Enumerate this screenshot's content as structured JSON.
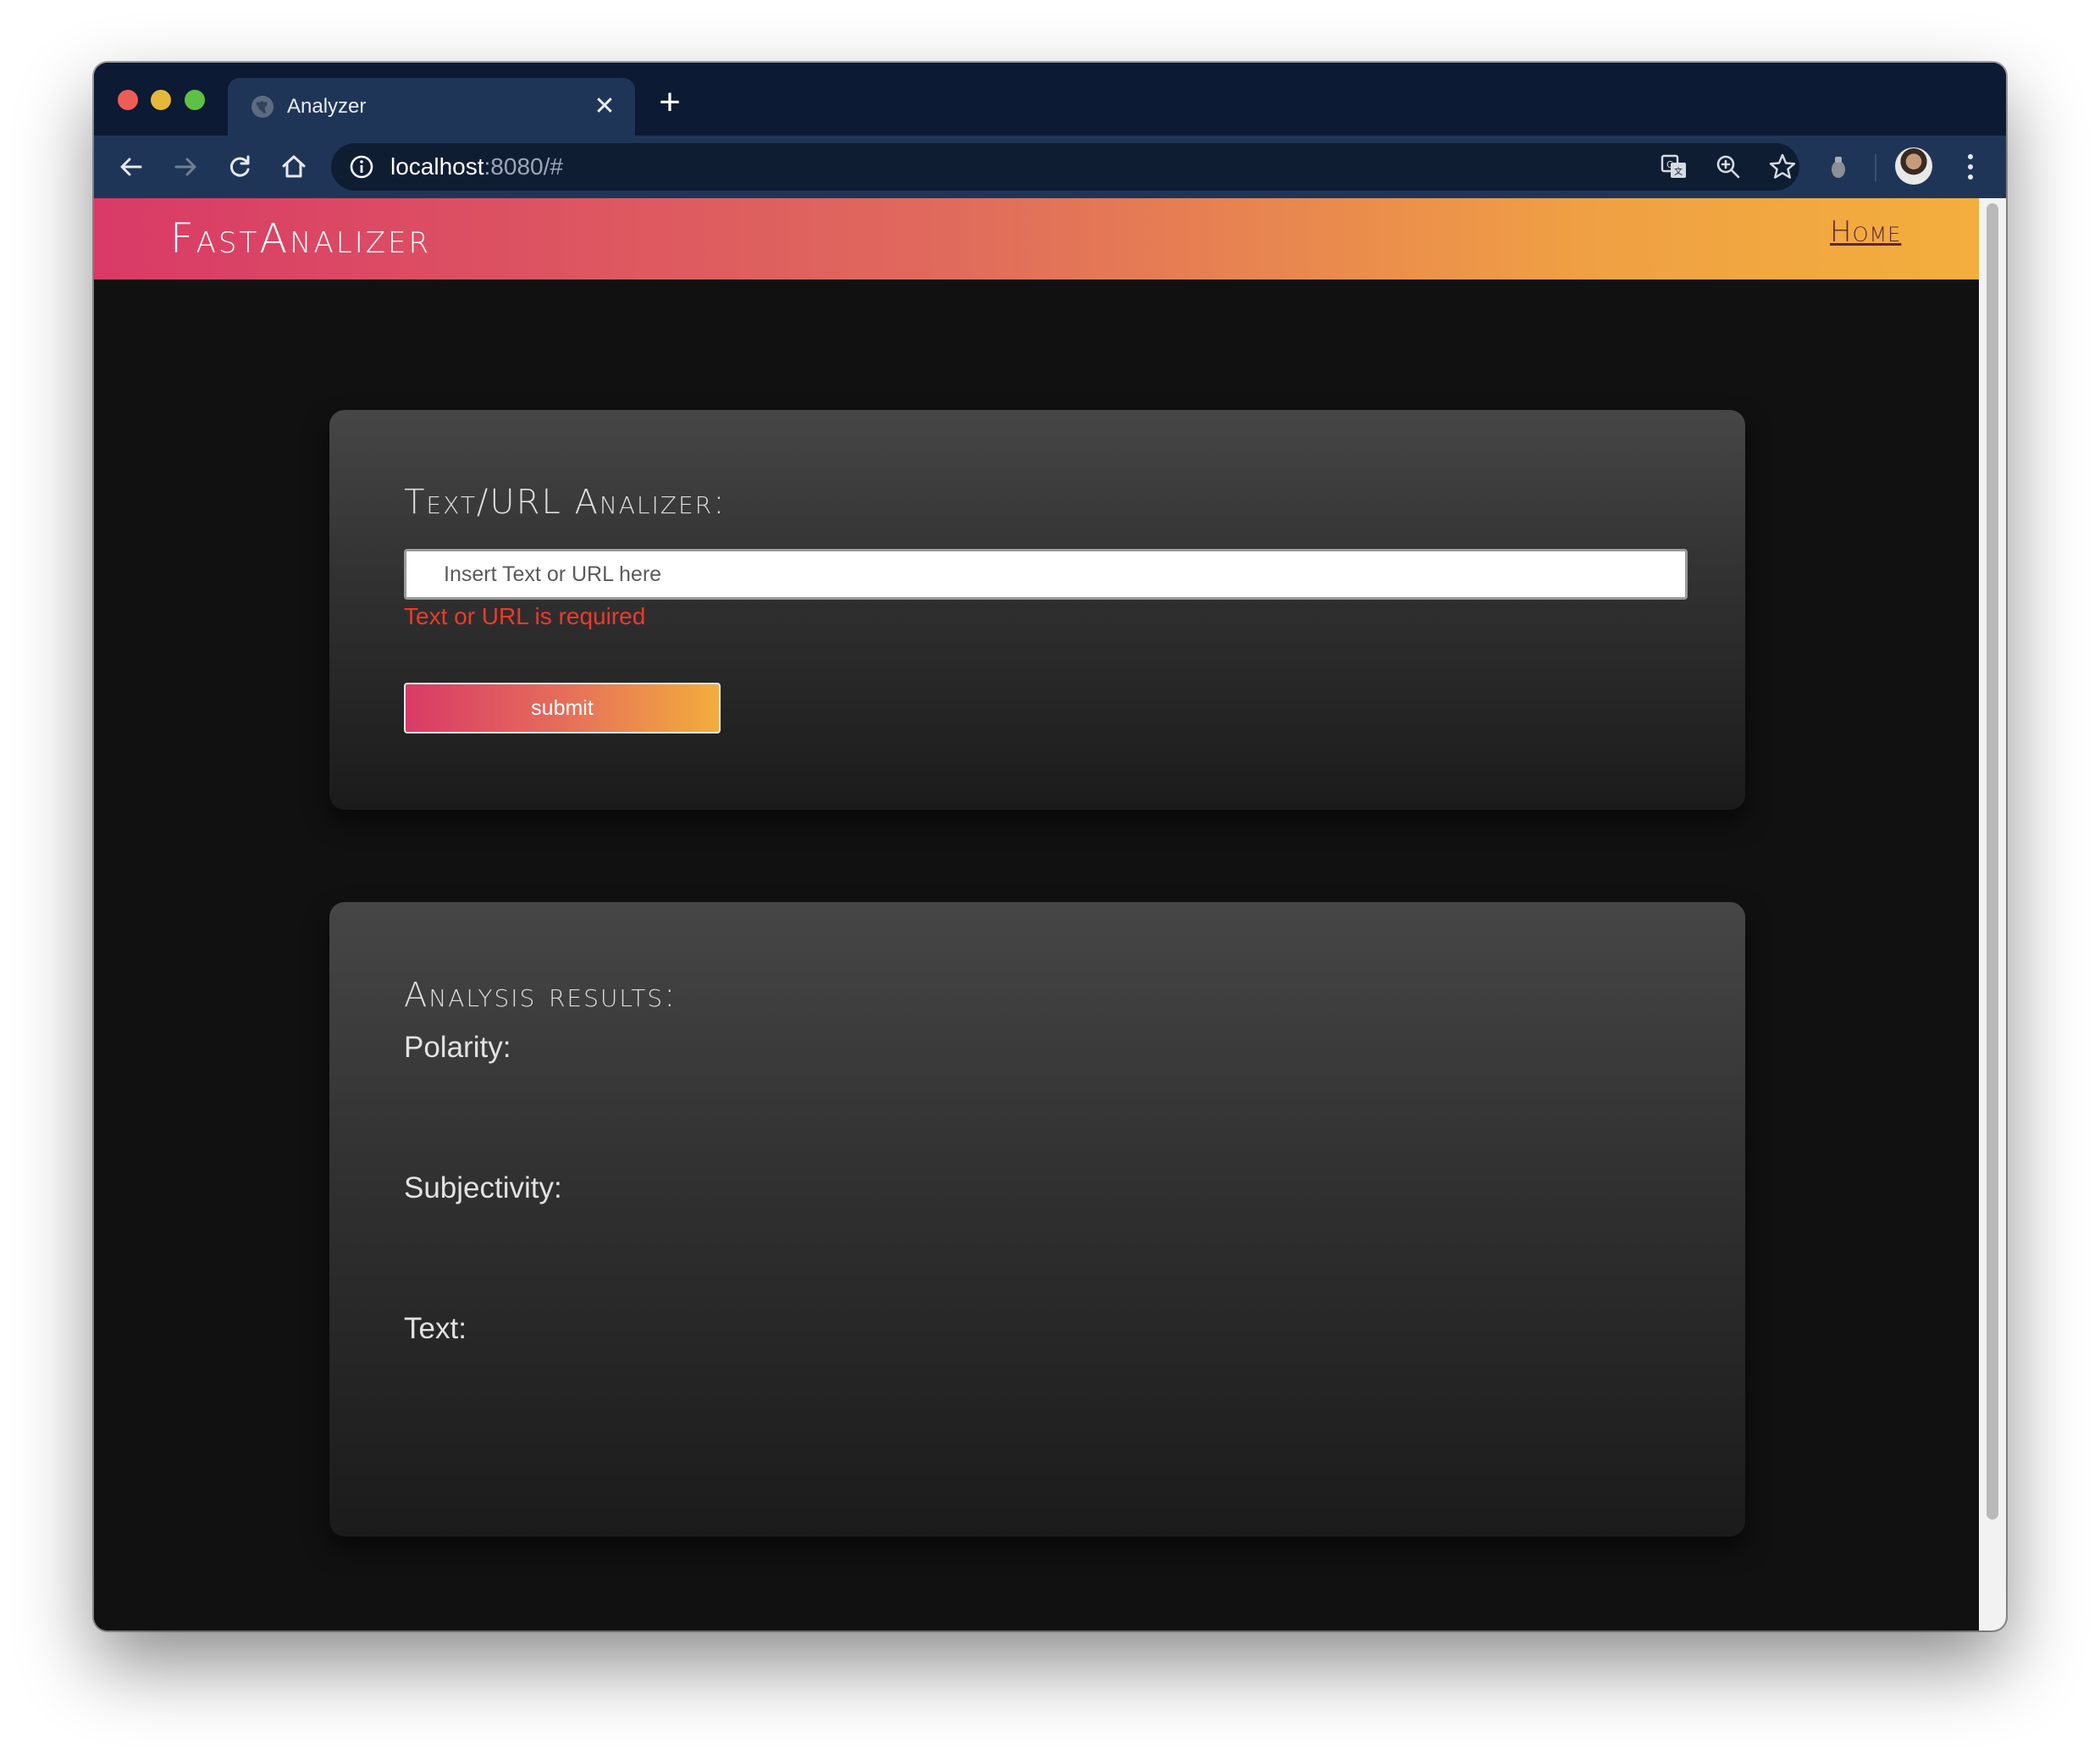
{
  "browser": {
    "tab_title": "Analyzer",
    "tab_close_glyph": "✕",
    "new_tab_glyph": "+",
    "url_host": "localhost",
    "url_rest": ":8080/#",
    "icons": [
      "back-arrow-icon",
      "forward-arrow-icon",
      "reload-icon",
      "home-icon",
      "info-icon",
      "translate-icon",
      "zoom-icon",
      "star-icon",
      "extension-icon",
      "avatar",
      "menu-dots-icon"
    ]
  },
  "header": {
    "brand": "FastAnalizer",
    "home_link": "Home",
    "gradient_start": "#d93a67",
    "gradient_end": "#f3ae3d"
  },
  "form": {
    "title": "Text/URL Analizer:",
    "input_placeholder": "Insert Text or URL here",
    "input_value": "",
    "error": "Text or URL is required",
    "submit_label": "submit",
    "error_color": "#ee3a2a"
  },
  "results": {
    "title": "Analysis results:",
    "polarity_label": "Polarity:",
    "subjectivity_label": "Subjectivity:",
    "text_label": "Text:"
  }
}
